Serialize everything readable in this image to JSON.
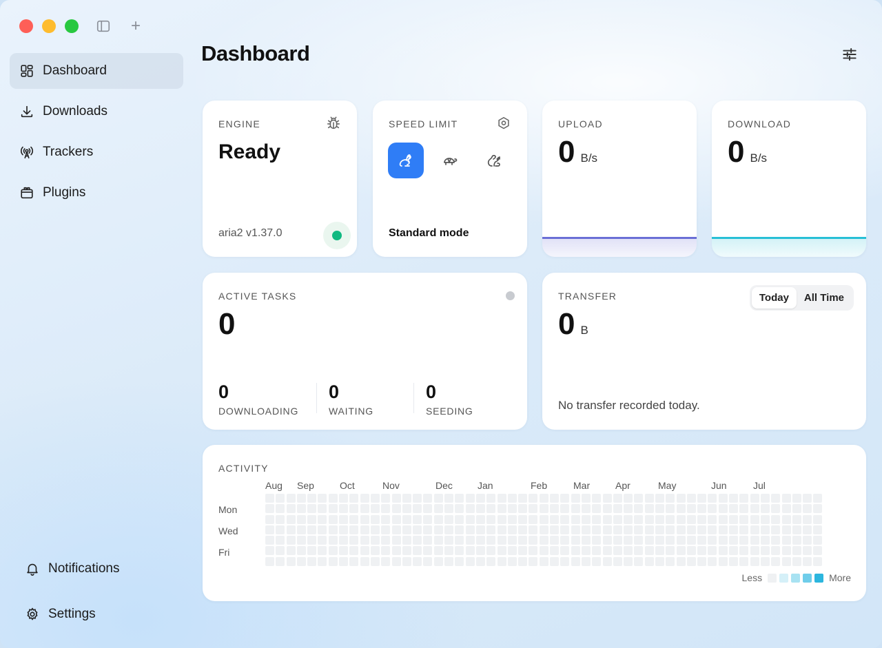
{
  "window": {
    "title": "Dashboard"
  },
  "sidebar": {
    "items": [
      {
        "id": "dashboard",
        "label": "Dashboard",
        "icon": "grid-icon",
        "active": true
      },
      {
        "id": "downloads",
        "label": "Downloads",
        "icon": "download-icon",
        "active": false
      },
      {
        "id": "trackers",
        "label": "Trackers",
        "icon": "antenna-icon",
        "active": false
      },
      {
        "id": "plugins",
        "label": "Plugins",
        "icon": "plugin-icon",
        "active": false
      }
    ],
    "bottom": [
      {
        "id": "notifications",
        "label": "Notifications",
        "icon": "bell-icon"
      },
      {
        "id": "settings",
        "label": "Settings",
        "icon": "gear-icon"
      }
    ]
  },
  "engine": {
    "label": "ENGINE",
    "status": "Ready",
    "version": "aria2 v1.37.0",
    "status_color": "#10b981"
  },
  "speed_limit": {
    "label": "SPEED LIMIT",
    "options": [
      {
        "id": "rabbit",
        "icon": "rabbit-icon",
        "active": true
      },
      {
        "id": "turtle",
        "icon": "turtle-icon",
        "active": false
      },
      {
        "id": "squirrel",
        "icon": "squirrel-icon",
        "active": false
      }
    ],
    "mode": "Standard mode"
  },
  "upload": {
    "label": "UPLOAD",
    "value": "0",
    "unit": "B/s",
    "color": "#6a6fd6"
  },
  "download": {
    "label": "DOWNLOAD",
    "value": "0",
    "unit": "B/s",
    "color": "#27bfd6"
  },
  "active_tasks": {
    "label": "ACTIVE TASKS",
    "value": "0",
    "stats": [
      {
        "value": "0",
        "label": "DOWNLOADING"
      },
      {
        "value": "0",
        "label": "WAITING"
      },
      {
        "value": "0",
        "label": "SEEDING"
      }
    ]
  },
  "transfer": {
    "label": "TRANSFER",
    "value": "0",
    "unit": "B",
    "tabs": [
      "Today",
      "All Time"
    ],
    "selected_tab": "Today",
    "empty_message": "No transfer recorded today."
  },
  "activity": {
    "label": "ACTIVITY",
    "months": [
      "Aug",
      "Sep",
      "Oct",
      "Nov",
      "Dec",
      "Jan",
      "Feb",
      "Mar",
      "Apr",
      "May",
      "Jun",
      "Jul"
    ],
    "days": [
      "Mon",
      "Wed",
      "Fri"
    ],
    "legend": {
      "less": "Less",
      "more": "More",
      "colors": [
        "#eff1f3",
        "#d5f0f8",
        "#a8e2f2",
        "#6fcdea",
        "#2cb6de"
      ]
    }
  },
  "accent": "#2f7df6"
}
